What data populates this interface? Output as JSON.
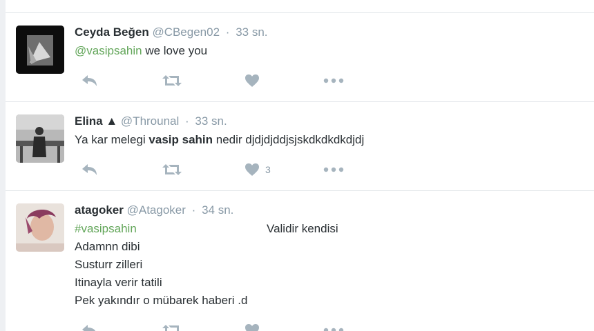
{
  "tweets": [
    {
      "name": "Ceyda Beğen",
      "handle": "@CBegen02",
      "time": "33 sn.",
      "mention": "@vasipsahin",
      "text_after_mention": "we love you"
    },
    {
      "name": "Elina ▲",
      "handle": "@Throunal",
      "time": "33 sn.",
      "text_before": "Ya kar melegi",
      "bold": "vasip sahin",
      "text_after": "nedir djdjdjddjsjskdkdkdkdjdj",
      "like_count": "3"
    },
    {
      "name": "atagoker",
      "handle": "@Atagoker",
      "time": "34 sn.",
      "hashtag": "#vasipsahin",
      "side_text": "Validir kendisi",
      "lines": [
        "Adamnn dibi",
        "Susturr zilleri",
        "Itinayla verir tatili",
        "Pek yakındır o mübarek haberi .d"
      ]
    }
  ],
  "icons": {
    "reply": "reply-icon",
    "retweet": "retweet-icon",
    "like": "heart-icon",
    "more": "more-icon"
  },
  "colors": {
    "mention": "#63a65a",
    "meta": "#8899a6",
    "action": "#a6b4be"
  }
}
